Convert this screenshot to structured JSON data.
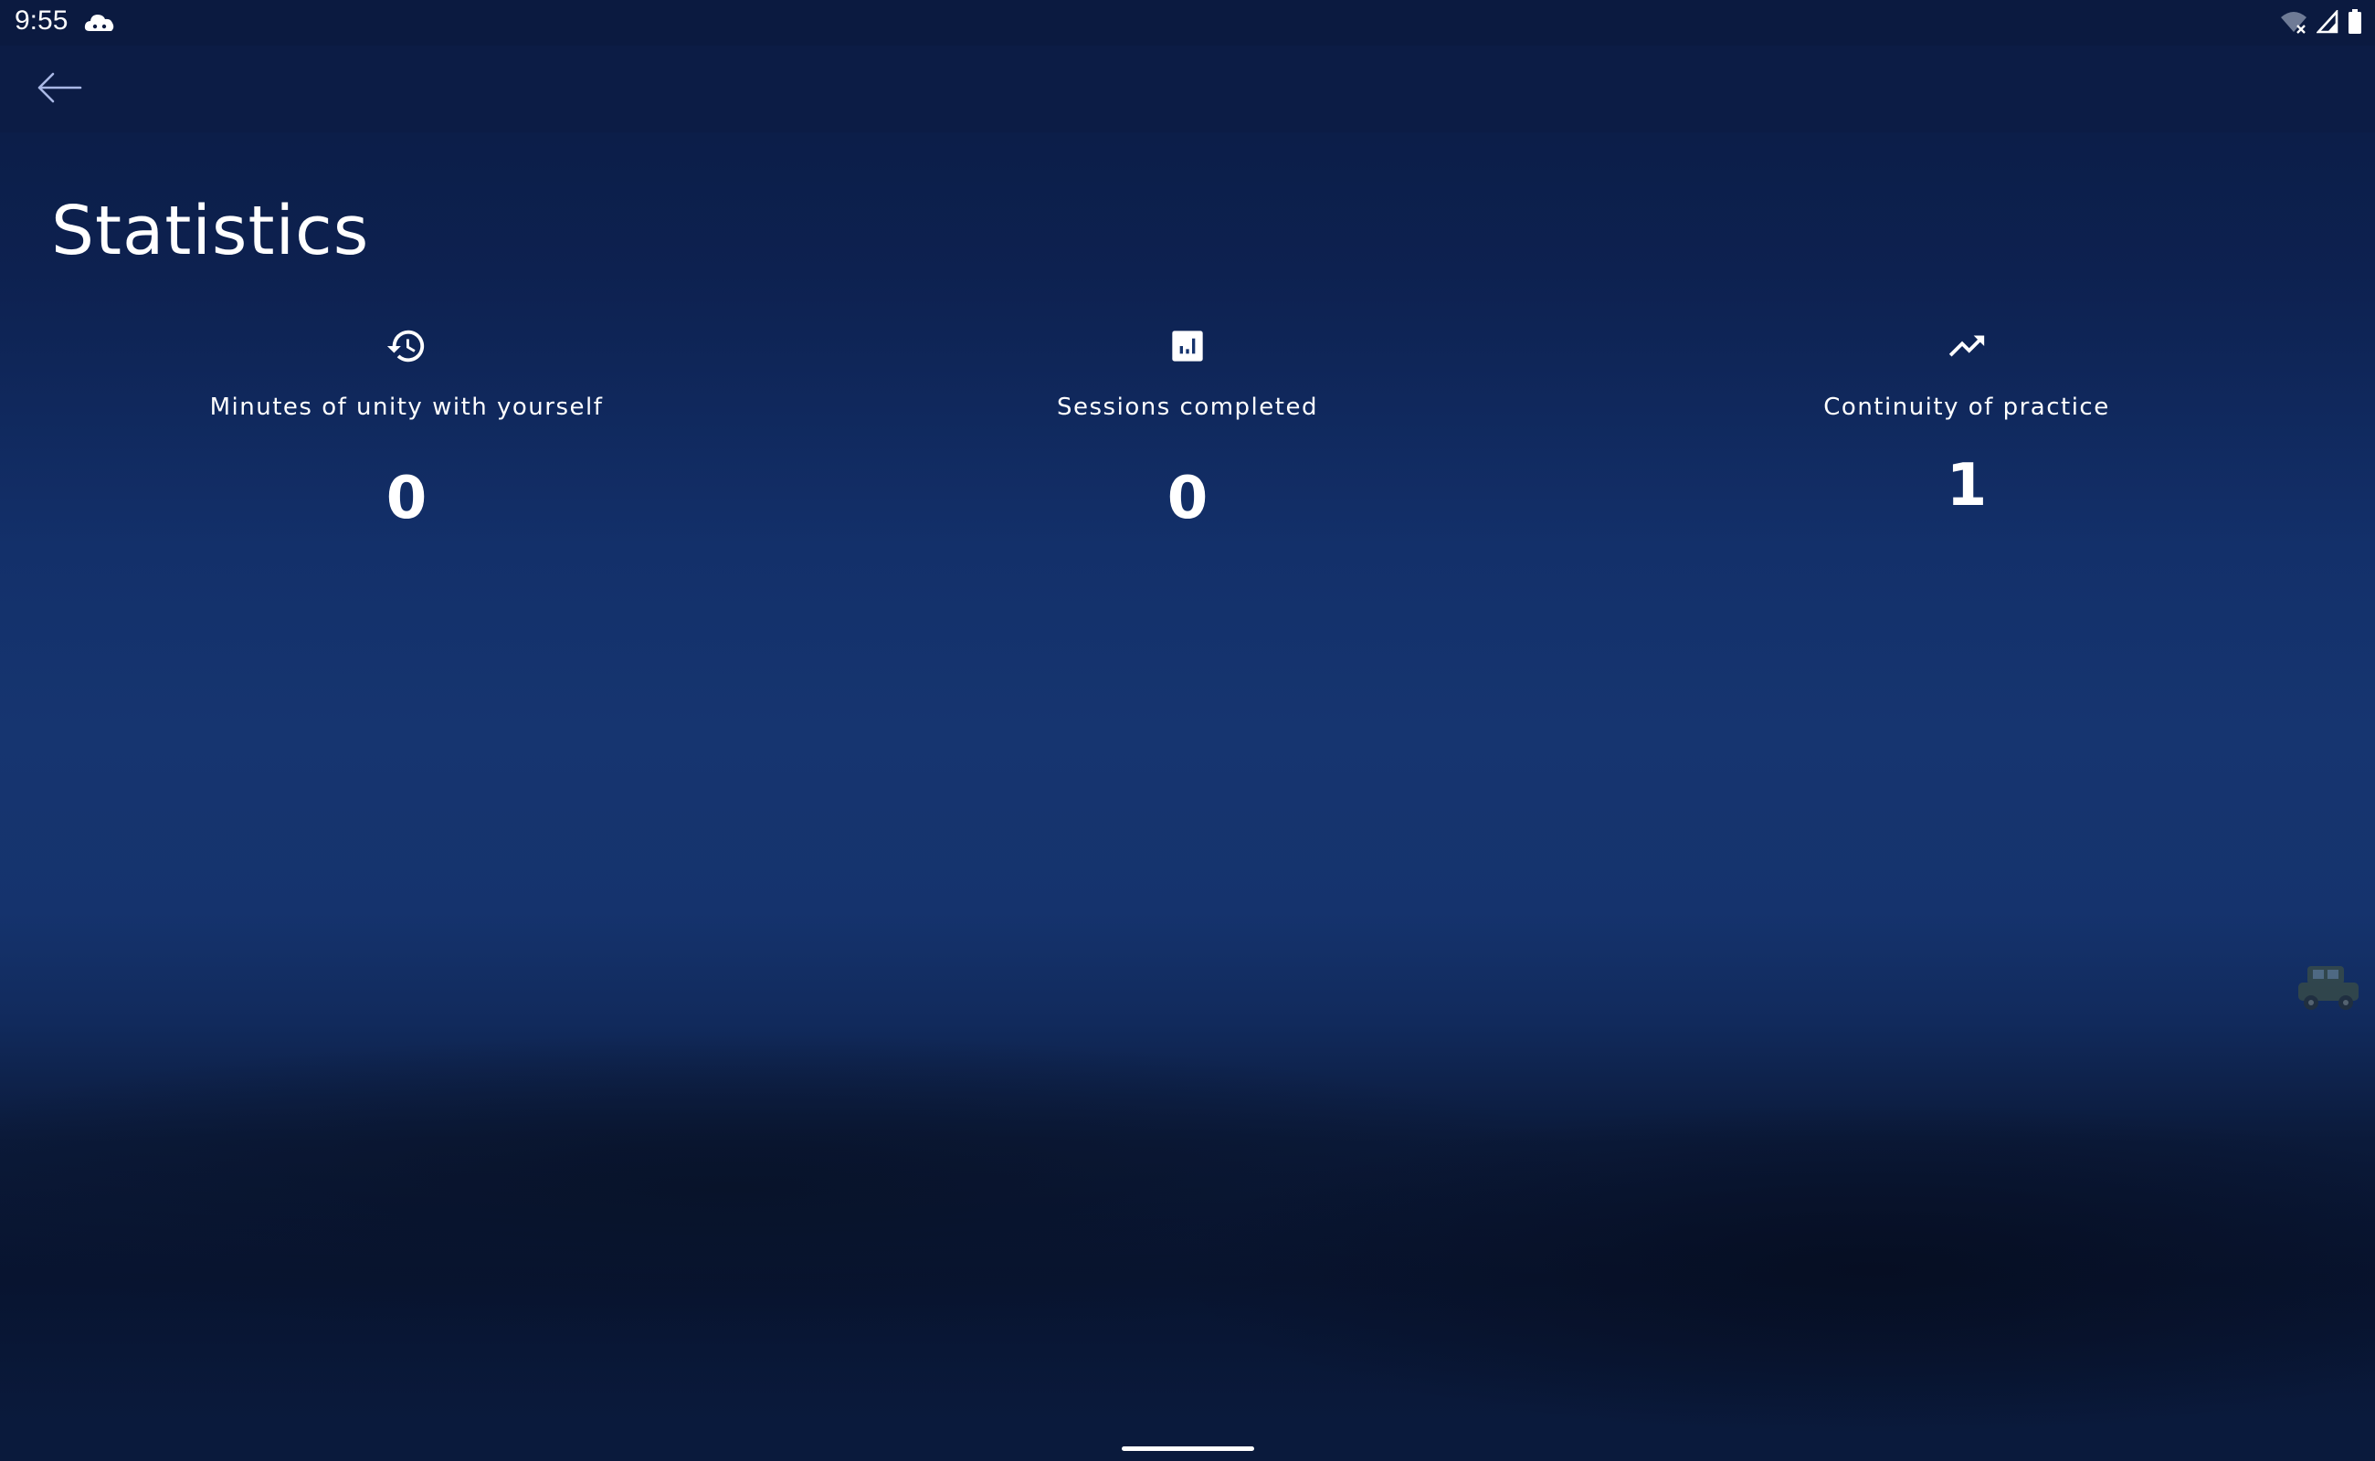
{
  "status_bar": {
    "time": "9:55"
  },
  "app_bar": {
    "back_icon": "arrow-left-icon"
  },
  "page": {
    "title": "Statistics"
  },
  "stats": [
    {
      "icon": "history-clock-icon",
      "label": "Minutes of unity with yourself",
      "value": "0"
    },
    {
      "icon": "bar-chart-icon",
      "label": "Sessions completed",
      "value": "0"
    },
    {
      "icon": "trending-up-icon",
      "label": "Continuity of practice",
      "value": "1"
    }
  ],
  "colors": {
    "background_top": "#0b1b42",
    "background_mid": "#163570",
    "background_bottom": "#081430",
    "text": "#ffffff",
    "back_arrow": "#a9b8e6"
  }
}
